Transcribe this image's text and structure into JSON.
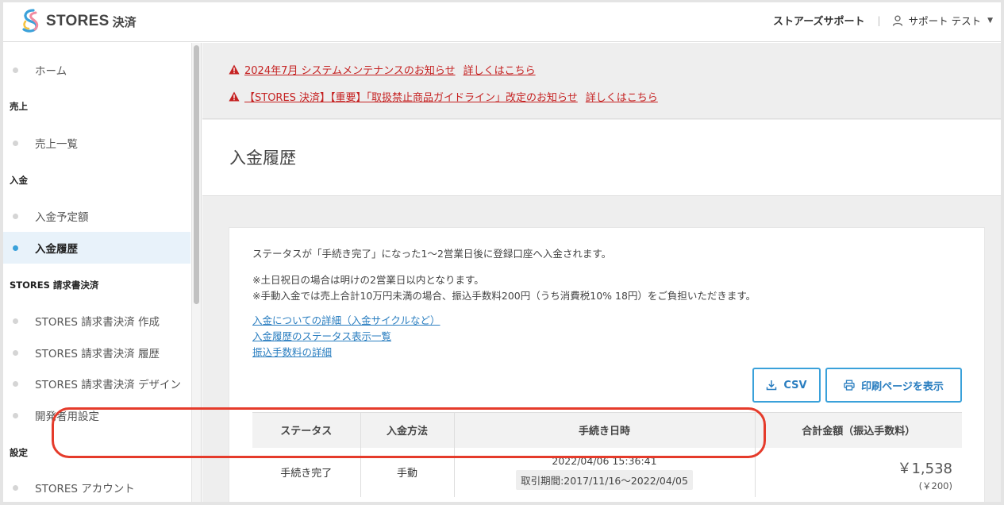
{
  "header": {
    "logo_text": "STORES",
    "logo_sub": "決済",
    "support_link": "ストアーズサポート",
    "separator": "|",
    "user_name": "サポート テスト",
    "caret": "▼"
  },
  "sidebar": {
    "items": [
      {
        "type": "item",
        "label": "ホーム"
      },
      {
        "type": "heading",
        "label": "売上"
      },
      {
        "type": "item",
        "label": "売上一覧"
      },
      {
        "type": "heading",
        "label": "入金"
      },
      {
        "type": "item",
        "label": "入金予定額"
      },
      {
        "type": "item",
        "label": "入金履歴",
        "active": true
      },
      {
        "type": "heading",
        "label": "STORES 請求書決済"
      },
      {
        "type": "item",
        "label": "STORES 請求書決済 作成"
      },
      {
        "type": "item",
        "label": "STORES 請求書決済 履歴"
      },
      {
        "type": "item",
        "label": "STORES 請求書決済 デザイン"
      },
      {
        "type": "item",
        "label": "開発者用設定"
      },
      {
        "type": "heading",
        "label": "設定"
      },
      {
        "type": "item",
        "label": "STORES アカウント"
      }
    ]
  },
  "notices": [
    {
      "text": "2024年7月 システムメンテナンスのお知らせ",
      "more": "詳しくはこちら"
    },
    {
      "text": "【STORES 決済】【重要】「取扱禁止商品ガイドライン」改定のお知らせ",
      "more": "詳しくはこちら"
    }
  ],
  "page": {
    "title": "入金履歴",
    "desc1": "ステータスが「手続き完了」になった1〜2営業日後に登録口座へ入金されます。",
    "desc2": "※土日祝日の場合は明けの2営業日以内となります。",
    "desc3": "※手動入金では売上合計10万円未満の場合、振込手数料200円（うち消費税10% 18円）をご負担いただきます。",
    "links": [
      "入金についての詳細（入金サイクルなど）",
      "入金履歴のステータス表示一覧",
      "振込手数料の詳細"
    ],
    "csv_button": "CSV",
    "print_button": "印刷ページを表示"
  },
  "table": {
    "headers": [
      "ステータス",
      "入金方法",
      "手続き日時",
      "合計金額（振込手数料）"
    ],
    "rows": [
      {
        "status": "手続き完了",
        "method": "手動",
        "datetime": "2022/04/06 15:36:41",
        "period": "取引期間:2017/11/16〜2022/04/05",
        "amount": "￥1,538",
        "fee": "(￥200)"
      }
    ]
  },
  "colors": {
    "accent": "#3aa1da",
    "notice_red": "#c52222",
    "highlight_red": "#e53b2b"
  }
}
